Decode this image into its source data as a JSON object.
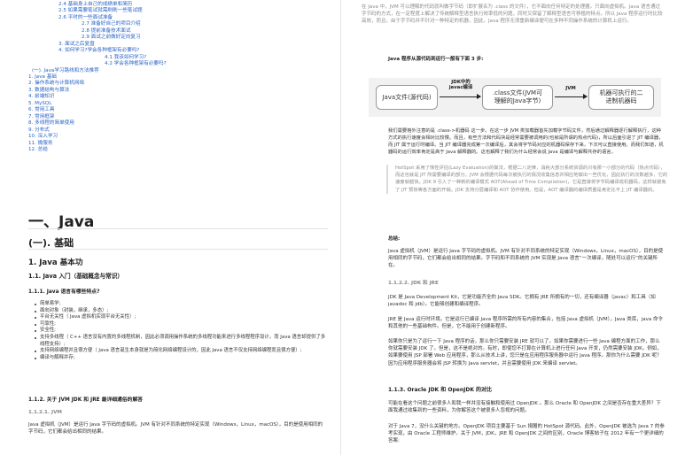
{
  "toc": [
    {
      "level": "l3",
      "text": "2.4 基础身上自己的成绩单和简历"
    },
    {
      "level": "l3",
      "text": "2.5 如果需要笔试就需刷刷一些笔试题"
    },
    {
      "level": "l3",
      "text": "2.6 平时的一些面试准备"
    },
    {
      "level": "l4",
      "text": "2.7 准备好自己的项目介绍"
    },
    {
      "level": "l4",
      "text": "2.8 提前准备技术面试"
    },
    {
      "level": "l4",
      "text": "2.9 面试之前做好定向复习"
    },
    {
      "level": "l3",
      "text": "3. 面试之后复盘"
    },
    {
      "level": "l3",
      "text": "4. 如何学习?学会各种框架有必要吗?"
    },
    {
      "level": "l5",
      "text": "4.1 我该如何学习?"
    },
    {
      "level": "l5",
      "text": "4.2 学会各种框架有必要吗?"
    },
    {
      "level": "l2",
      "text": "(一). Java学习路线和方法推荐"
    },
    {
      "level": "l1",
      "text": "1. Java 基础"
    },
    {
      "level": "l1",
      "text": "2. 操作系统与计算机网络"
    },
    {
      "level": "l1",
      "text": "3. 数据结构与算法"
    },
    {
      "level": "l1",
      "text": "4. 前端知识"
    },
    {
      "level": "l1",
      "text": "5. MySQL"
    },
    {
      "level": "l1",
      "text": "6. 常用工具"
    },
    {
      "level": "l1",
      "text": "7. 常用框架"
    },
    {
      "level": "l1",
      "text": "8. 多线程的简单使用"
    },
    {
      "level": "l1",
      "text": "9. 分布式"
    },
    {
      "level": "l1",
      "text": "10. 深入学习"
    },
    {
      "level": "l1",
      "text": "11. 微服务"
    },
    {
      "level": "l1",
      "text": "12. 总结"
    }
  ],
  "left": {
    "h1": "一、Java",
    "h2": "(一). 基础",
    "h3": "1. Java 基本功",
    "h4_1": "1.1. Java 入门（基础概念与常识）",
    "h5_1": "1.1.1. Java 语言有哪些特点?",
    "features": [
      "简单易学;",
      "面向对象（封装，继承，多态）;",
      "平台无关性（ Java 虚拟机实现平台无关性）;",
      "可靠性;",
      "安全性;",
      "支持多线程（ C++ 语言没有内置的多线程机制，因此必须调用操作系统的多线程功能来进行多线程程序设计，而 Java 语言却提供了多线程支持）;",
      "支持网络编程并且很方便（ Java 语言诞生本身就是为简化网络编程设计的，因此 Java 语言不仅支持网络编程而且很方便）;",
      "编译与解释并存;"
    ],
    "h5_2": "1.1.2. 关于 JVM JDK 和 JRE 最详细通俗的解答",
    "h6_1": "1.1.2.1. JVM",
    "jvm_para": "Java 虚拟机（JVM）是运行 Java 字节码的虚拟机。JVM 有针对不同系统的特定实现（Windows，Linux，macOS），目的是使用相同的字节码，它们都会给出相同的结果。"
  },
  "right": {
    "intro": "在 Java 中，JVM 可以理解的代码就叫做字节码（即扩展名为 .class 的文件），它不面向任何特定的处理器，只面向虚拟机。Java 语言通过字节码的方式，在一定程度上解决了传统解释型语言执行效率低的问题，同时又保留了解释型语言可移植的特点。所以 Java 程序运行时比较高效，而且，由于字节码并不针对一种特定的机器，因此，Java 程序无须重新编译便可在多种不同操作系统的计算机上运行。",
    "steps_title": "Java 程序从源代码到运行一般有下面 3 步:",
    "diagram": {
      "box1": "Java文件(源代码)",
      "arrow1_label": "JDK中的\njavac编译",
      "box2": ".class文件(JVM可\n理解的Java字节)",
      "arrow2_label": "JVM",
      "box3": "机器可执行的二\n进制机器码"
    },
    "para1": "我们需要格外注意的是 .class->机器码 这一步。在这一步 JVM 类加载器首先加载字节码文件，然后通过解释器逐行解释执行，这种方式的执行速度会相对比较慢。而且，有些方法和代码块是经常需要被调用的(也就是所谓的热点代码)，所以后面引进了 JIT 编译器，而 JIT 属于运行时编译。当 JIT 编译器完成第一次编译后，其会将字节码对应的机器码保存下来，下次可以直接使用。而我们知道，机器码的运行效率肯定是高于 Java 解释器的。这也解释了我们为什么经常会说 Java 是编译与解释共存的语言。",
    "quote": "HotSpot 采用了惰性评估(Lazy Evaluation)的做法，根据二八定律，消耗大部分系统资源的只有那一小部分的代码（热点代码），而这也就是 JIT 所需要编译的部分。JVM 会根据代码每次被执行的情况收集信息并相应地做出一些优化，因此执行的次数越多，它的速度就越快。JDK 9 引入了一种新的编译模式 AOT(Ahead of Time Compilation)，它是直接将字节码编译成机器码，这样就避免了 JIT 预热等各方面的开销。JDK 支持分层编译和 AOT 协作使用。但是，AOT 编译器的编译质量是肯定比不上 JIT 编译器的。",
    "summary_title": "总结:",
    "summary": "Java 虚拟机（JVM）是运行 Java 字节码的虚拟机。JVM 有针对不同系统的特定实现（Windows，Linux，macOS），目的是使用相同的字节码，它们都会给出相同的结果。字节码和不同系统的 JVM 实现是 Java 语言“一次编译，随处可以运行”的关键所在。",
    "h6_2": "1.1.2.2. JDK 和 JRE",
    "jdk_para": "JDK 是 Java Development Kit，它是功能齐全的 Java SDK。它拥有 JRE 所拥有的一切，还有编译器（javac）和工具（如 javadoc 和 jdb）。它能够创建和编译程序。",
    "jre_para": "JRE 是 Java 运行时环境。它是运行已编译 Java 程序所需的所有内容的集合，包括 Java 虚拟机（JVM），Java 类库，java 命令和其他的一些基础构件。但是，它不能用于创建新程序。",
    "web_para": "如果你只是为了运行一下 Java 程序的话，那么你只需要安装 JRE 就可以了。如果你需要进行一些 Java 编程方面的工作，那么你就需要安装 JDK 了。但是，这不是绝对的。有时，即使您不打算在计算机上进行任何 Java 开发，仍然需要安装 JDK。例如，如果要使用 JSP 部署 Web 应用程序，那么从技术上讲，您只是在应用程序服务器中运行 Java 程序。那你为什么需要 JDK 呢？因为应用程序服务器会将 JSP 转换为 Java servlet，并且需要使用 JDK 来编译 servlet。",
    "h5_3": "1.1.3. Oracle JDK 和 OpenJDK 的对比",
    "oracle_para1": "可能在看这个问题之前很多人和我一样并没有接触和使用过 OpenJDK 。那么 Oracle 和 OpenJDK 之间是否存在重大差异？下面我通过收集到的一些资料，为你解答这个被很多人忽视的问题。",
    "oracle_para2": "对于 Java 7，没什么关键的地方。OpenJDK 项目主要基于 Sun 捐赠的 HotSpot 源代码。此外，OpenJDK 被选为 Java 7 的参考实现，由 Oracle 工程师维护。关于 JVM，JDK，JRE 和 OpenJDK 之间的区别，Oracle 博客帖子在 2012 年有一个更详细的答案:"
  }
}
